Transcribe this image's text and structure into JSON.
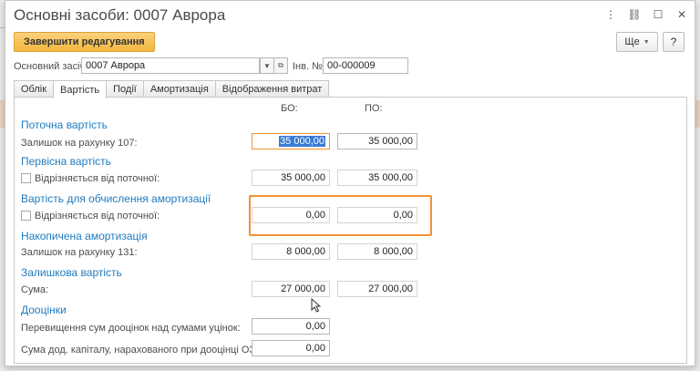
{
  "window": {
    "title": "Основні засоби: 0007 Аврора",
    "controls": {
      "menu": "⋮",
      "minimize": "–",
      "maximize": "☐",
      "close": "✕"
    }
  },
  "toolbar": {
    "finish_label": "Завершити редагування",
    "more_label": "Ще",
    "help_label": "?"
  },
  "header": {
    "asset_label": "Основний засіб:",
    "asset_value": "0007 Аврора",
    "inv_label": "Інв. №:",
    "inv_value": "00-000009"
  },
  "tabs": [
    "Облік",
    "Вартість",
    "Події",
    "Амортизація",
    "Відображення витрат"
  ],
  "active_tab": "Вартість",
  "columns": {
    "bo": "БО:",
    "po": "ПО:"
  },
  "sections": {
    "current": {
      "title": "Поточна вартість",
      "row_label": "Залишок на рахунку 107:",
      "bo": "35 000,00",
      "po": "35 000,00"
    },
    "initial": {
      "title": "Первісна вартість",
      "row_label": "Відрізняється від поточної:",
      "bo": "35 000,00",
      "po": "35 000,00"
    },
    "depreciation_calc": {
      "title": "Вартість для обчислення амортизації",
      "row_label": "Відрізняється від поточної:",
      "bo": "0,00",
      "po": "0,00"
    },
    "accumulated": {
      "title": "Накопичена амортизація",
      "row_label": "Залишок на рахунку 131:",
      "bo": "8 000,00",
      "po": "8 000,00"
    },
    "residual": {
      "title": "Залишкова вартість",
      "row_label": "Сума:",
      "bo": "27 000,00",
      "po": "27 000,00"
    },
    "revaluation": {
      "title": "Дооцінки",
      "row1_label": "Перевищення сум дооцінок над сумами уцінок:",
      "row1_value": "0,00",
      "row2_label": "Сума дод. капіталу, нарахованого при дооцінці ОЗ:",
      "row2_value": "0,00"
    }
  },
  "colors": {
    "accent": "#f3b63e",
    "section_title": "#1f7bc0",
    "highlight": "#f39233",
    "selection": "#3a7bd5"
  }
}
